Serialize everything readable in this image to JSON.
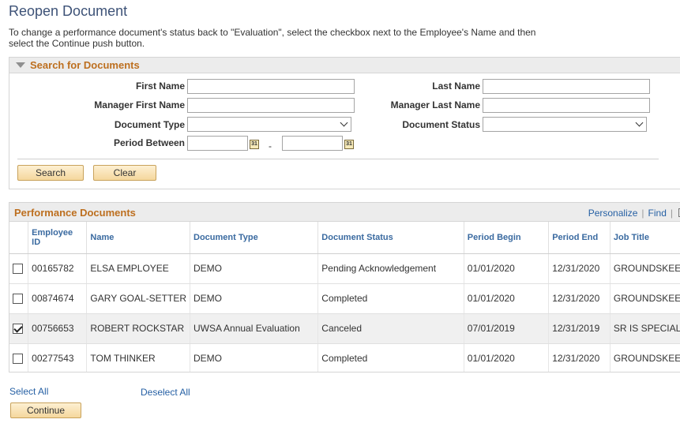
{
  "page": {
    "title": "Reopen Document",
    "instructions": "To change a performance document's status back to \"Evaluation\", select the checkbox next to the Employee's Name and then select the Continue push button."
  },
  "search": {
    "header": "Search for Documents",
    "first_name_label": "First Name",
    "last_name_label": "Last Name",
    "manager_first_name_label": "Manager First Name",
    "manager_last_name_label": "Manager Last Name",
    "document_type_label": "Document Type",
    "document_status_label": "Document Status",
    "period_between_label": "Period Between",
    "period_separator": "-",
    "first_name_value": "",
    "last_name_value": "",
    "manager_first_name_value": "",
    "manager_last_name_value": "",
    "document_type_value": "",
    "document_status_value": "",
    "period_start_value": "",
    "period_end_value": "",
    "search_button": "Search",
    "clear_button": "Clear"
  },
  "grid": {
    "title": "Performance Documents",
    "personalize": "Personalize",
    "find": "Find",
    "columns": [
      "Employee ID",
      "Name",
      "Document Type",
      "Document Status",
      "Period Begin",
      "Period End",
      "Job Title"
    ],
    "rows": [
      {
        "checked": false,
        "employee_id": "00165782",
        "name": "ELSA EMPLOYEE",
        "document_type": "DEMO",
        "document_status": "Pending Acknowledgement",
        "period_begin": "01/01/2020",
        "period_end": "12/31/2020",
        "job_title": "GROUNDSKEEPER"
      },
      {
        "checked": false,
        "employee_id": "00874674",
        "name": "GARY GOAL-SETTER",
        "document_type": "DEMO",
        "document_status": "Completed",
        "period_begin": "01/01/2020",
        "period_end": "12/31/2020",
        "job_title": "GROUNDSKEEPER"
      },
      {
        "checked": true,
        "employee_id": "00756653",
        "name": "ROBERT ROCKSTAR",
        "document_type": "UWSA Annual Evaluation",
        "document_status": "Canceled",
        "period_begin": "07/01/2019",
        "period_end": "12/31/2019",
        "job_title": "SR IS SPECIALIST"
      },
      {
        "checked": false,
        "employee_id": "00277543",
        "name": "TOM THINKER",
        "document_type": "DEMO",
        "document_status": "Completed",
        "period_begin": "01/01/2020",
        "period_end": "12/31/2020",
        "job_title": "GROUNDSKEEPER"
      }
    ]
  },
  "footer": {
    "select_all": "Select All",
    "deselect_all": "Deselect All",
    "continue_button": "Continue"
  }
}
